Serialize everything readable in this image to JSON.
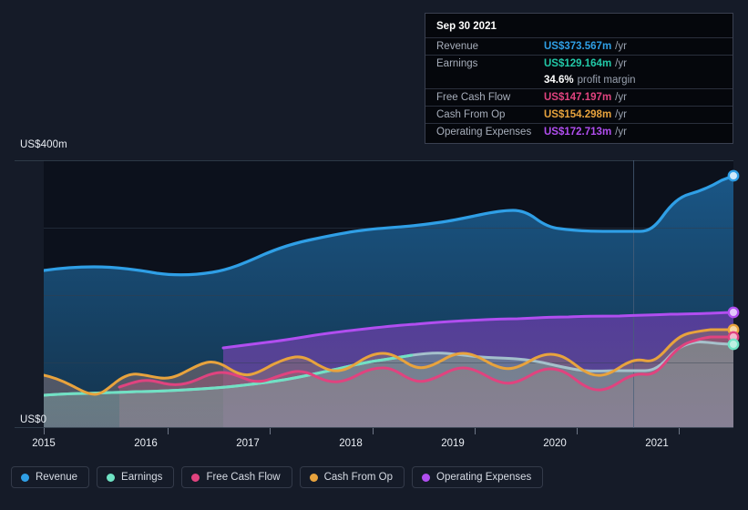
{
  "axis": {
    "y_top_label": "US$400m",
    "y_zero_label": "US$0",
    "x_ticks": [
      "2015",
      "2016",
      "2017",
      "2018",
      "2019",
      "2020",
      "2021"
    ]
  },
  "tooltip": {
    "date": "Sep 30 2021",
    "unit": "/yr",
    "rows": [
      {
        "label": "Revenue",
        "value": "US$373.567m",
        "color": "#2f9fe6"
      },
      {
        "label": "Earnings",
        "value": "US$129.164m",
        "color": "#22c9a8"
      },
      {
        "label": "Free Cash Flow",
        "value": "US$147.197m",
        "color": "#e0437f"
      },
      {
        "label": "Cash From Op",
        "value": "US$154.298m",
        "color": "#e8a33d"
      },
      {
        "label": "Operating Expenses",
        "value": "US$172.713m",
        "color": "#b14ef0"
      }
    ],
    "margin_value": "34.6%",
    "margin_text": "profit margin"
  },
  "legend": [
    {
      "label": "Revenue",
      "color": "#2f9fe6"
    },
    {
      "label": "Earnings",
      "color": "#6fe3c4"
    },
    {
      "label": "Free Cash Flow",
      "color": "#e0437f"
    },
    {
      "label": "Cash From Op",
      "color": "#e8a33d"
    },
    {
      "label": "Operating Expenses",
      "color": "#b14ef0"
    }
  ],
  "chart_data": {
    "type": "area",
    "title": "",
    "xlabel": "",
    "ylabel": "US$",
    "ylim": [
      0,
      400
    ],
    "yunit": "m",
    "grid": true,
    "gridlines_y": [
      0,
      100,
      200,
      300,
      400
    ],
    "legend_position": "bottom-left",
    "x_range": [
      "2015",
      "2021-Q3"
    ],
    "x_ticks": [
      2015,
      2016,
      2017,
      2018,
      2019,
      2020,
      2021
    ],
    "forecast_divider_x": 2020.78,
    "latest_period": "Sep 30 2021",
    "series": [
      {
        "name": "Revenue",
        "color": "#2f9fe6",
        "x": [
          2014.77,
          2015.0,
          2015.25,
          2015.5,
          2015.75,
          2016.0,
          2016.25,
          2016.5,
          2016.75,
          2017.0,
          2017.25,
          2017.5,
          2017.75,
          2018.0,
          2018.25,
          2018.5,
          2018.75,
          2019.0,
          2019.25,
          2019.5,
          2019.75,
          2020.0,
          2020.25,
          2020.5,
          2020.75,
          2021.0,
          2021.25,
          2021.5,
          2021.75
        ],
        "values": [
          232,
          234,
          235,
          236,
          235,
          233,
          231,
          228,
          230,
          238,
          252,
          266,
          278,
          286,
          292,
          296,
          298,
          302,
          305,
          308,
          310,
          312,
          300,
          293,
          291,
          290,
          316,
          344,
          374
        ],
        "latest": 373.567
      },
      {
        "name": "Operating Expenses",
        "color": "#b14ef0",
        "x": [
          2016.72,
          2017.0,
          2017.5,
          2018.0,
          2018.5,
          2019.0,
          2019.5,
          2020.0,
          2020.5,
          2021.0,
          2021.5,
          2021.75
        ],
        "values": [
          121,
          125,
          134,
          143,
          150,
          154,
          158,
          161,
          164,
          167,
          170,
          172.713
        ],
        "latest": 172.713
      },
      {
        "name": "Cash From Op",
        "color": "#e8a33d",
        "x": [
          2014.77,
          2015.0,
          2015.25,
          2015.5,
          2015.75,
          2016.0,
          2016.25,
          2016.5,
          2016.75,
          2017.0,
          2017.25,
          2017.5,
          2017.75,
          2018.0,
          2018.25,
          2018.5,
          2018.75,
          2019.0,
          2019.25,
          2019.5,
          2019.75,
          2020.0,
          2020.25,
          2020.5,
          2020.75,
          2021.0,
          2021.25,
          2021.5,
          2021.75
        ],
        "values": [
          80,
          76,
          70,
          62,
          58,
          66,
          76,
          73,
          70,
          72,
          76,
          84,
          90,
          84,
          78,
          84,
          96,
          104,
          98,
          92,
          102,
          112,
          116,
          104,
          96,
          100,
          118,
          136,
          154.298
        ],
        "latest": 154.298
      },
      {
        "name": "Free Cash Flow",
        "color": "#e0437f",
        "x": [
          2015.72,
          2016.0,
          2016.25,
          2016.5,
          2016.75,
          2017.0,
          2017.25,
          2017.5,
          2017.75,
          2018.0,
          2018.25,
          2018.5,
          2018.75,
          2019.0,
          2019.25,
          2019.5,
          2019.75,
          2020.0,
          2020.25,
          2020.5,
          2020.75,
          2021.0,
          2021.25,
          2021.5,
          2021.75
        ],
        "values": [
          62,
          66,
          70,
          67,
          64,
          66,
          72,
          80,
          84,
          78,
          72,
          78,
          90,
          98,
          92,
          86,
          94,
          104,
          108,
          96,
          88,
          92,
          112,
          132,
          147.197
        ],
        "latest": 147.197
      },
      {
        "name": "Earnings",
        "color": "#6fe3c4",
        "x": [
          2014.77,
          2015.0,
          2015.5,
          2016.0,
          2016.5,
          2017.0,
          2017.5,
          2018.0,
          2018.5,
          2019.0,
          2019.25,
          2019.5,
          2019.75,
          2020.0,
          2020.25,
          2020.5,
          2020.75,
          2021.0,
          2021.25,
          2021.5,
          2021.75
        ],
        "values": [
          48,
          49,
          50,
          51,
          52,
          53,
          56,
          60,
          66,
          76,
          82,
          86,
          84,
          88,
          92,
          86,
          80,
          82,
          100,
          118,
          129.164
        ],
        "latest": 129.164
      }
    ]
  }
}
